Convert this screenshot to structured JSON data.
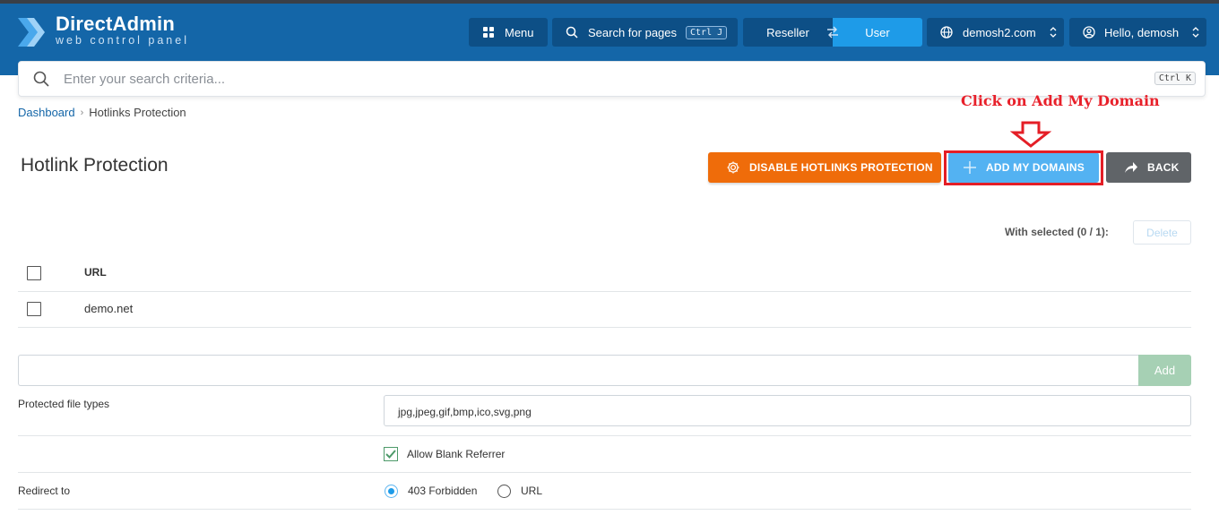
{
  "header": {
    "logo_title": "DirectAdmin",
    "logo_subtitle": "web control panel",
    "menu_label": "Menu",
    "search_pages_label": "Search for pages",
    "search_pages_shortcut": "Ctrl J",
    "role_reseller": "Reseller",
    "role_user": "User",
    "domain_label": "demosh2.com",
    "user_label": "Hello, demosh"
  },
  "search": {
    "placeholder": "Enter your search criteria...",
    "shortcut": "Ctrl K"
  },
  "breadcrumb": {
    "items": [
      "Dashboard",
      "Hotlinks Protection"
    ]
  },
  "annotation": {
    "text": "Click on Add My Domain"
  },
  "page": {
    "title": "Hotlink Protection"
  },
  "actions": {
    "disable_label": "DISABLE HOTLINKS PROTECTION",
    "add_domains_label": "ADD MY DOMAINS",
    "back_label": "BACK"
  },
  "table": {
    "with_selected": "With selected (0 / 1):",
    "delete_label": "Delete",
    "header_url": "URL",
    "rows": [
      "demo.net"
    ]
  },
  "form": {
    "add_label": "Add",
    "add_value": "",
    "protected_file_types_label": "Protected file types",
    "protected_file_types_value": "jpg,jpeg,gif,bmp,ico,svg,png",
    "allow_blank_referrer_label": "Allow Blank Referrer",
    "allow_blank_referrer_checked": true,
    "redirect_to_label": "Redirect to",
    "redirect_options": [
      "403 Forbidden",
      "URL"
    ],
    "redirect_selected": "403 Forbidden"
  },
  "colors": {
    "header_bg": "#1466a8",
    "orange": "#ef6c0a",
    "light_blue": "#53b2f2",
    "highlight_red": "#e41e26",
    "gray_button": "#606468",
    "green_add": "#a6d0b4"
  }
}
